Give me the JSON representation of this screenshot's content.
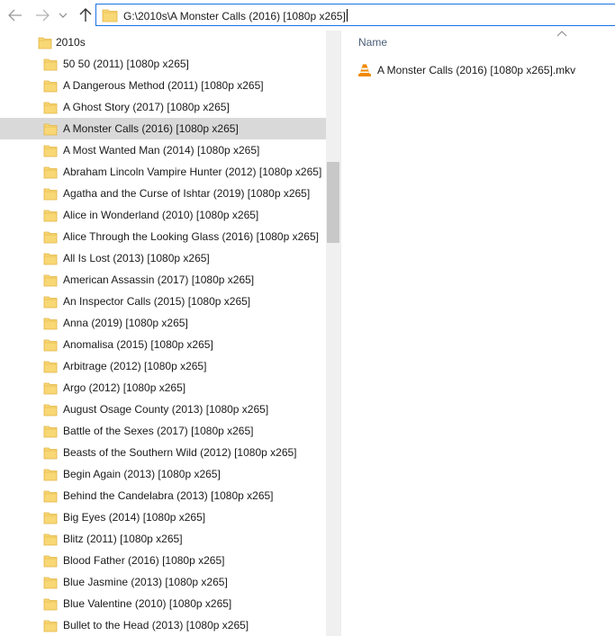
{
  "navigation": {
    "back_icon": "arrow-left-icon",
    "forward_icon": "arrow-right-icon",
    "recent_icon": "chevron-down-icon",
    "up_icon": "arrow-up-icon",
    "address_path": "G:\\2010s\\A Monster Calls (2016) [1080p x265]"
  },
  "tree": {
    "root_label": "2010s",
    "selected_index": 3,
    "items": [
      "50 50 (2011) [1080p x265]",
      "A Dangerous Method (2011) [1080p x265]",
      "A Ghost Story (2017) [1080p x265]",
      "A Monster Calls (2016) [1080p x265]",
      "A Most Wanted Man (2014) [1080p x265]",
      "Abraham Lincoln Vampire Hunter (2012) [1080p x265]",
      "Agatha and the Curse of Ishtar (2019) [1080p x265]",
      "Alice in Wonderland (2010) [1080p x265]",
      "Alice Through the Looking Glass (2016) [1080p x265]",
      "All Is Lost (2013) [1080p x265]",
      "American Assassin (2017) [1080p x265]",
      "An Inspector Calls (2015) [1080p x265]",
      "Anna (2019) [1080p x265]",
      "Anomalisa (2015) [1080p x265]",
      "Arbitrage (2012) [1080p x265]",
      "Argo (2012) [1080p x265]",
      "August Osage County (2013) [1080p x265]",
      "Battle of the Sexes (2017) [1080p x265]",
      "Beasts of the Southern Wild (2012) [1080p x265]",
      "Begin Again (2013) [1080p x265]",
      "Behind the Candelabra (2013) [1080p x265]",
      "Big Eyes (2014) [1080p x265]",
      "Blitz (2011) [1080p x265]",
      "Blood Father (2016) [1080p x265]",
      "Blue Jasmine (2013) [1080p x265]",
      "Blue Valentine (2010) [1080p x265]",
      "Bullet to the Head (2013) [1080p x265]"
    ]
  },
  "content": {
    "column_name": "Name",
    "sort_icon": "chevron-up-icon",
    "files": [
      {
        "name": "A Monster Calls (2016) [1080p x265].mkv",
        "icon": "vlc-cone-icon"
      }
    ]
  },
  "colors": {
    "folder": "#f8d775",
    "selected_row": "#d9d9d9",
    "address_border": "#1a73e8",
    "header_text": "#4c607a",
    "vlc_orange": "#f08a00"
  }
}
